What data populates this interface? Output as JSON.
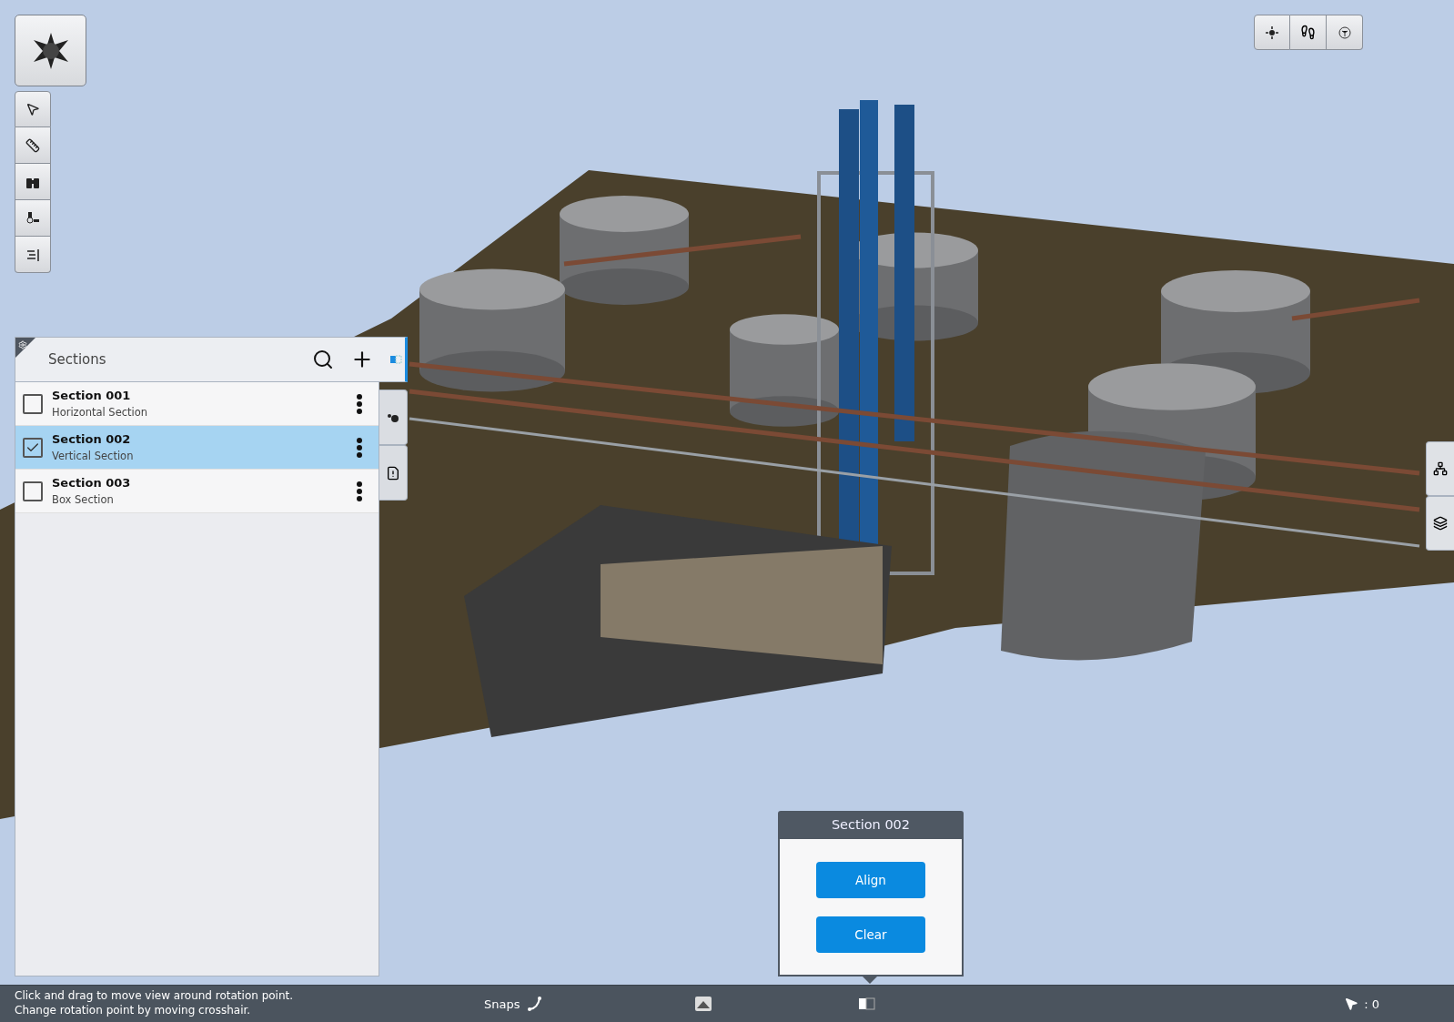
{
  "sections_panel": {
    "title": "Sections",
    "items": [
      {
        "name": "Section 001",
        "type": "Horizontal Section",
        "checked": false,
        "selected": false
      },
      {
        "name": "Section 002",
        "type": "Vertical Section",
        "checked": true,
        "selected": true
      },
      {
        "name": "Section 003",
        "type": "Box Section",
        "checked": false,
        "selected": false
      }
    ]
  },
  "section_popup": {
    "title": "Section 002",
    "buttons": [
      "Align",
      "Clear"
    ]
  },
  "status_bar": {
    "message": "Click and drag to move view around rotation point. Change rotation point by moving crosshair.",
    "snaps_label": "Snaps",
    "selection_count": ": 0"
  }
}
